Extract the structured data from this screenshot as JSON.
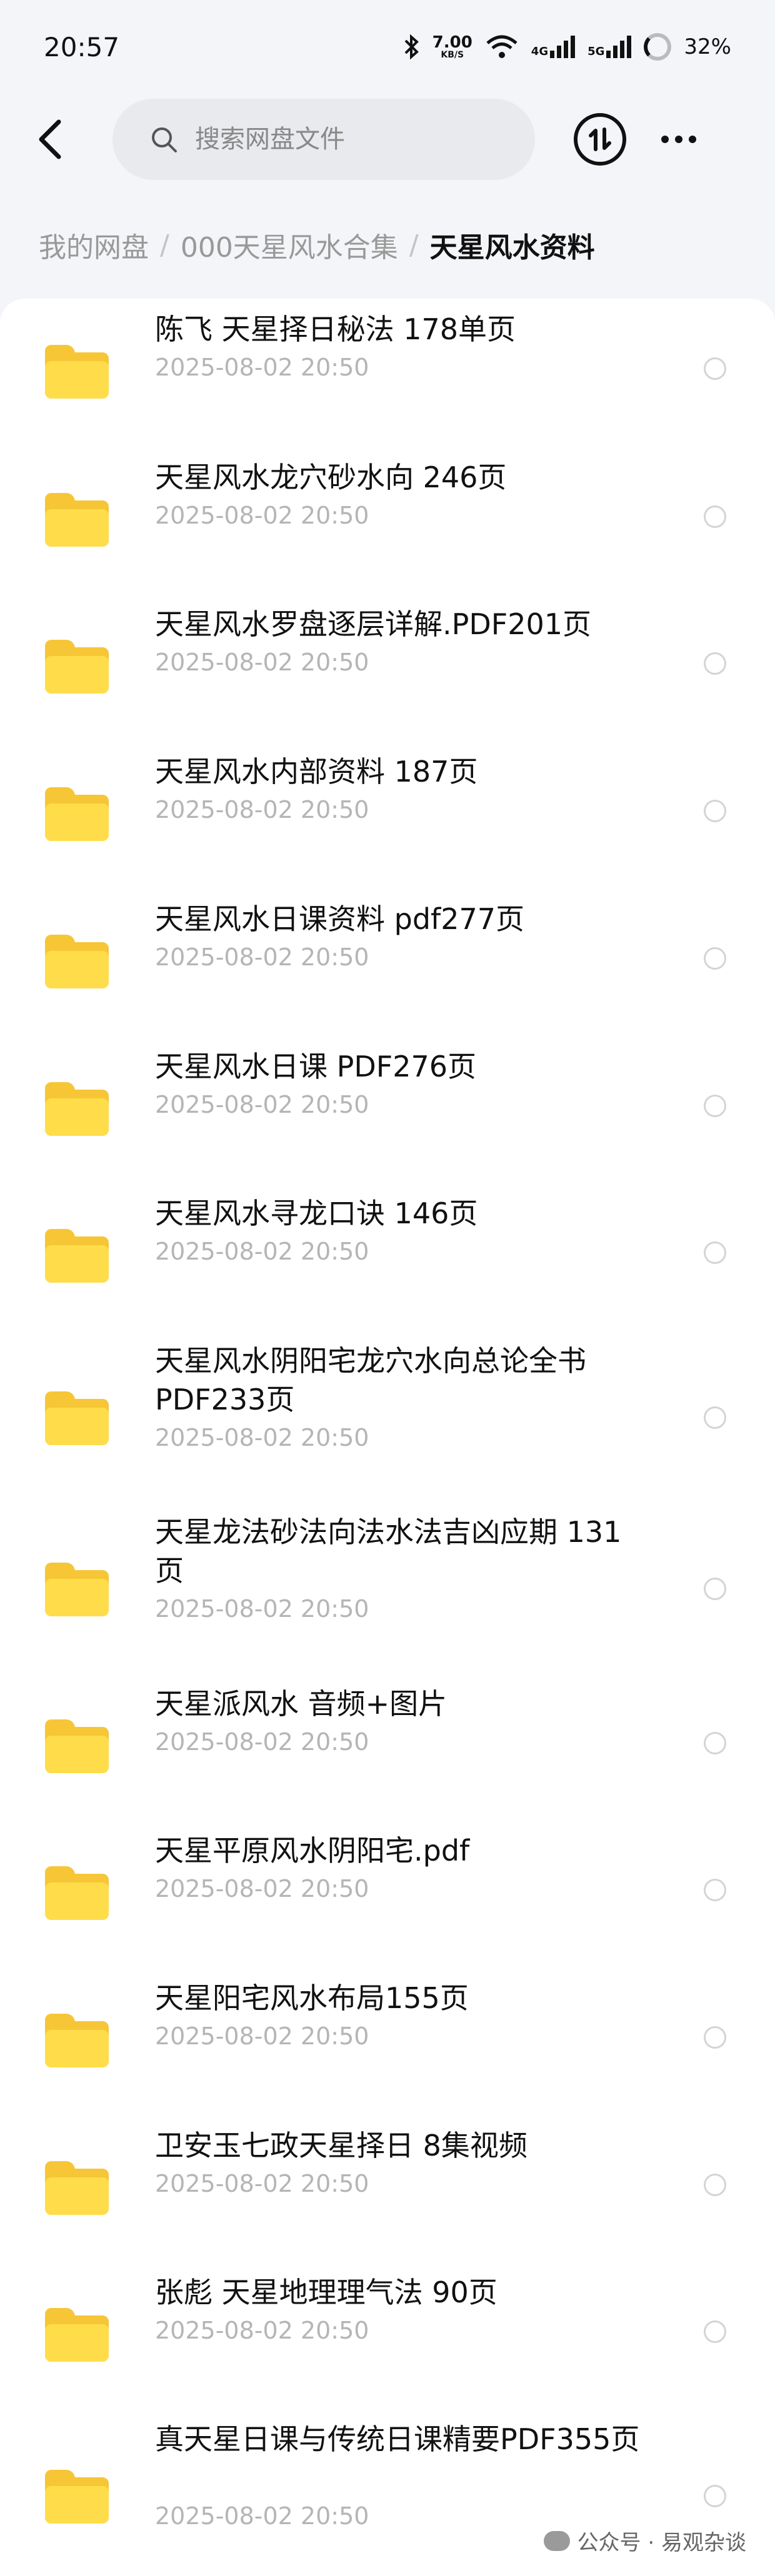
{
  "status_bar": {
    "time": "20:57",
    "net_speed": "7.00",
    "net_speed_unit": "KB/S",
    "signal1": "4G",
    "signal2": "5G",
    "battery": "32%",
    "icons": [
      "bluetooth-icon",
      "wifi-icon",
      "signal-icon",
      "battery-icon"
    ]
  },
  "header": {
    "search_placeholder": "搜索网盘文件",
    "icons": [
      "back-icon",
      "search-icon",
      "transfer-icon",
      "more-icon"
    ]
  },
  "breadcrumb": {
    "items": [
      "我的网盘",
      "000天星风水合集",
      "天星风水资料"
    ],
    "separator": "/"
  },
  "files": [
    {
      "name": "陈飞 天星择日秘法 178单页",
      "date": "2025-08-02  20:50"
    },
    {
      "name": "天星风水龙穴砂水向 246页",
      "date": "2025-08-02  20:50"
    },
    {
      "name": "天星风水罗盘逐层详解.PDF201页",
      "date": "2025-08-02  20:50"
    },
    {
      "name": "天星风水内部资料 187页",
      "date": "2025-08-02  20:50"
    },
    {
      "name": "天星风水日课资料 pdf277页",
      "date": "2025-08-02  20:50"
    },
    {
      "name": "天星风水日课 PDF276页",
      "date": "2025-08-02  20:50"
    },
    {
      "name": "天星风水寻龙口诀 146页",
      "date": "2025-08-02  20:50"
    },
    {
      "name": "天星风水阴阳宅龙穴水向总论全书PDF233页",
      "date": "2025-08-02  20:50"
    },
    {
      "name": "天星龙法砂法向法水法吉凶应期 131页",
      "date": "2025-08-02  20:50"
    },
    {
      "name": "天星派风水 音频+图片",
      "date": "2025-08-02  20:50"
    },
    {
      "name": "天星平原风水阴阳宅.pdf",
      "date": "2025-08-02  20:50"
    },
    {
      "name": "天星阳宅风水布局155页",
      "date": "2025-08-02  20:50"
    },
    {
      "name": "卫安玉七政天星择日 8集视频",
      "date": "2025-08-02  20:50"
    },
    {
      "name": "张彪 天星地理理气法 90页",
      "date": "2025-08-02  20:50"
    },
    {
      "name": "真天星日课与传统日课精要PDF355页",
      "date": "2025-08-02  20:50"
    }
  ],
  "watermark": {
    "text": "公众号 · 易观杂谈"
  },
  "colors": {
    "folder": "#ffdd4a",
    "background": "#f3f5f8",
    "date_text": "#b5b5b5"
  }
}
